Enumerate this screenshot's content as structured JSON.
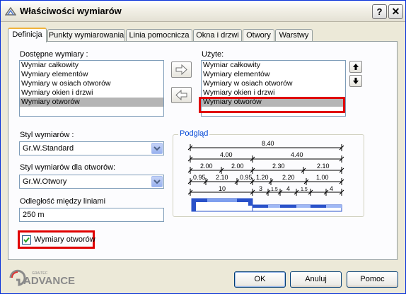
{
  "window": {
    "title": "Właściwości wymiarów",
    "help_label": "?",
    "close_label": "✕"
  },
  "tabs": [
    {
      "label": "Definicja"
    },
    {
      "label": "Punkty wymiarowania"
    },
    {
      "label": "Linia pomocnicza"
    },
    {
      "label": "Okna i drzwi"
    },
    {
      "label": "Otwory"
    },
    {
      "label": "Warstwy"
    }
  ],
  "available": {
    "label": "Dostępne wymiary :",
    "items": [
      "Wymiar całkowity",
      "Wymiary elementów",
      "Wymiary w osiach otworów",
      "Wymiary okien i drzwi",
      "Wymiary otworów"
    ],
    "selected_index": 4
  },
  "used": {
    "label": "Użyte:",
    "items": [
      "Wymiar całkowity",
      "Wymiary elementów",
      "Wymiary w osiach otworów",
      "Wymiary okien i drzwi",
      "Wymiary otworów"
    ],
    "selected_index": 4
  },
  "dimension_style": {
    "label": "Styl wymiarów :",
    "value": "Gr.W.Standard"
  },
  "opening_style": {
    "label": "Styl wymiarów dla otworów:",
    "value": "Gr.W.Otwory"
  },
  "line_spacing": {
    "label": "Odległość między liniami",
    "value": "250 m"
  },
  "preview": {
    "label": "Podgląd",
    "row1": [
      "8.40"
    ],
    "row2": [
      "4.00",
      "4.40"
    ],
    "row3": [
      "2.00",
      "2.00",
      "2.30",
      "2.10"
    ],
    "row4": [
      "0.95",
      "2.10",
      "0.95",
      "1.20",
      "2.20",
      "1.00"
    ],
    "row5": [
      "10",
      "3",
      "1.5",
      "4",
      "1.5",
      "4"
    ]
  },
  "openings_checkbox": {
    "label": "Wymiary otworów",
    "checked": true
  },
  "buttons": {
    "ok": "OK",
    "cancel": "Anuluj",
    "help": "Pomoc"
  },
  "logo": {
    "brand_small": "GRAITEC",
    "brand": "ADVANCE"
  },
  "colors": {
    "highlight": "#e00000",
    "group_label": "#0046d5",
    "wall_blue": "#2a52c9"
  }
}
